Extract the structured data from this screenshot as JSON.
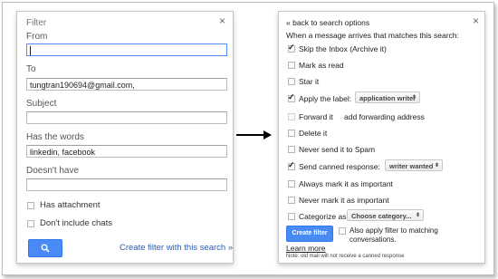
{
  "left_panel": {
    "title": "Filter",
    "close": "×",
    "fields": [
      {
        "label": "From",
        "value": "",
        "focused": true
      },
      {
        "label": "To",
        "value": "tungtran190694@gmail.com,"
      },
      {
        "label": "Subject",
        "value": ""
      },
      {
        "label": "Has the words",
        "value": "linkedin, facebook"
      },
      {
        "label": "Doesn't have",
        "value": ""
      }
    ],
    "checkboxes": [
      {
        "label": "Has attachment",
        "checked": false
      },
      {
        "label": "Don't include chats",
        "checked": false
      }
    ],
    "search_button_icon": "search-icon",
    "create_filter_link": "Create filter with this search »"
  },
  "right_panel": {
    "back_link": "« back to search options",
    "close": "×",
    "intro": "When a message arrives that matches this search:",
    "options": {
      "skip_inbox": {
        "label": "Skip the Inbox (Archive it)",
        "checked": true
      },
      "mark_read": {
        "label": "Mark as read",
        "checked": false
      },
      "star": {
        "label": "Star it",
        "checked": false
      },
      "apply_label": {
        "label": "Apply the label:",
        "checked": true,
        "dropdown": "application writer"
      },
      "forward": {
        "label": "Forward it",
        "checked": false,
        "link": "add forwarding address"
      },
      "delete": {
        "label": "Delete it",
        "checked": false
      },
      "never_spam": {
        "label": "Never send it to Spam",
        "checked": false
      },
      "canned": {
        "label": "Send canned response:",
        "checked": true,
        "dropdown": "writer wanted"
      },
      "always_important": {
        "label": "Always mark it as important",
        "checked": false
      },
      "never_important": {
        "label": "Never mark it as important",
        "checked": false
      },
      "categorize": {
        "label": "Categorize as:",
        "checked": false,
        "dropdown": "Choose category..."
      }
    },
    "create_filter_button": "Create filter",
    "also_apply": {
      "label_line1": "Also apply filter to matching",
      "label_line2": "conversations.",
      "checked": false
    },
    "learn_more": "Learn more",
    "note": "Note: old mail will not receive a canned response"
  },
  "colors": {
    "accent": "#4a8af4",
    "link": "#1155cc"
  }
}
